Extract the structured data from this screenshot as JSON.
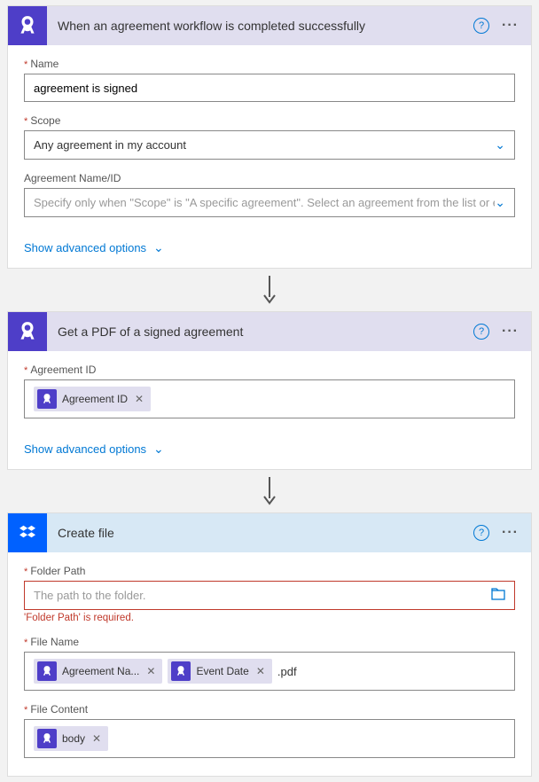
{
  "card1": {
    "title": "When an agreement workflow is completed successfully",
    "name_label": "Name",
    "name_value": "agreement is signed",
    "scope_label": "Scope",
    "scope_value": "Any agreement in my account",
    "agreement_label": "Agreement Name/ID",
    "agreement_placeholder": "Specify only when \"Scope\" is \"A specific agreement\". Select an agreement from the list or enter th",
    "advanced": "Show advanced options"
  },
  "card2": {
    "title": "Get a PDF of a signed agreement",
    "agreement_id_label": "Agreement ID",
    "token_agreement_id": "Agreement ID",
    "advanced": "Show advanced options"
  },
  "card3": {
    "title": "Create file",
    "folder_label": "Folder Path",
    "folder_placeholder": "The path to the folder.",
    "folder_error": "'Folder Path' is required.",
    "filename_label": "File Name",
    "token_agreement_name": "Agreement Na...",
    "token_event_date": "Event Date",
    "filename_suffix": ".pdf",
    "filecontent_label": "File Content",
    "token_body": "body"
  }
}
